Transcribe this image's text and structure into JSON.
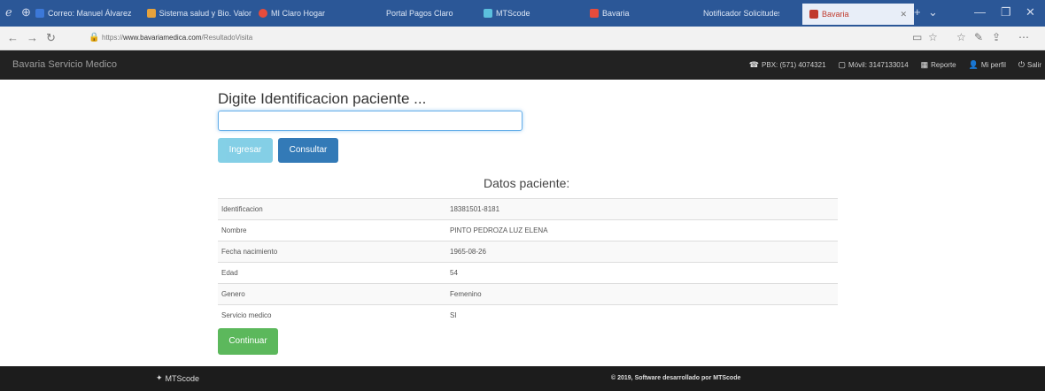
{
  "browser": {
    "tabs": [
      {
        "label": "Correo: Manuel Álvarez",
        "color": "#3c78d8"
      },
      {
        "label": "Sistema salud y Bio. Valor",
        "color": "#e6a23c"
      },
      {
        "label": "MI Claro Hogar",
        "color": "#e74c3c"
      },
      {
        "label": "Portal Pagos Claro",
        "color": ""
      },
      {
        "label": "MTScode",
        "color": "#5bc0de"
      },
      {
        "label": "Bavaria",
        "color": "#e74c3c"
      },
      {
        "label": "Notificador Solicitudes",
        "color": "#5cb85c"
      },
      {
        "label": "Bavaria",
        "color": "#c0392b"
      }
    ],
    "url_domain": "www.bavariamedica.com",
    "url_path": "/ResultadoVisita",
    "url_prefix": "https://"
  },
  "navbar": {
    "brand": "Bavaria Servicio Medico",
    "items": [
      {
        "icon": "phone-icon",
        "glyph": "☎",
        "label": "PBX: (571) 4074321"
      },
      {
        "icon": "calendar-icon",
        "glyph": "▢",
        "label": "Móvil: 3147133014"
      },
      {
        "icon": "report-icon",
        "glyph": "▦",
        "label": "Reporte"
      },
      {
        "icon": "user-icon",
        "glyph": "👤",
        "label": "Mi perfil"
      },
      {
        "icon": "power-icon",
        "glyph": "⏻",
        "label": "Salir"
      }
    ]
  },
  "main": {
    "prompt": "Digite Identificacion paciente ...",
    "input_value": "",
    "btn_ingresar": "Ingresar",
    "btn_consultar": "Consultar",
    "datos_title": "Datos paciente:",
    "rows": [
      {
        "label": "Identificacion",
        "value": "18381501-8181"
      },
      {
        "label": "Nombre",
        "value": "PINTO PEDROZA LUZ ELENA"
      },
      {
        "label": "Fecha nacimiento",
        "value": "1965-08-26"
      },
      {
        "label": "Edad",
        "value": "54"
      },
      {
        "label": "Genero",
        "value": "Femenino"
      },
      {
        "label": "Servicio medico",
        "value": "SI"
      }
    ],
    "btn_continuar": "Continuar"
  },
  "footer": {
    "logo": "MTScode",
    "copyright": "© 2019, Software desarrollado por MTScode"
  },
  "colors": {
    "primary": "#337ab7",
    "info": "#5bc0de",
    "success": "#5cb85c",
    "navbar": "#222222"
  }
}
